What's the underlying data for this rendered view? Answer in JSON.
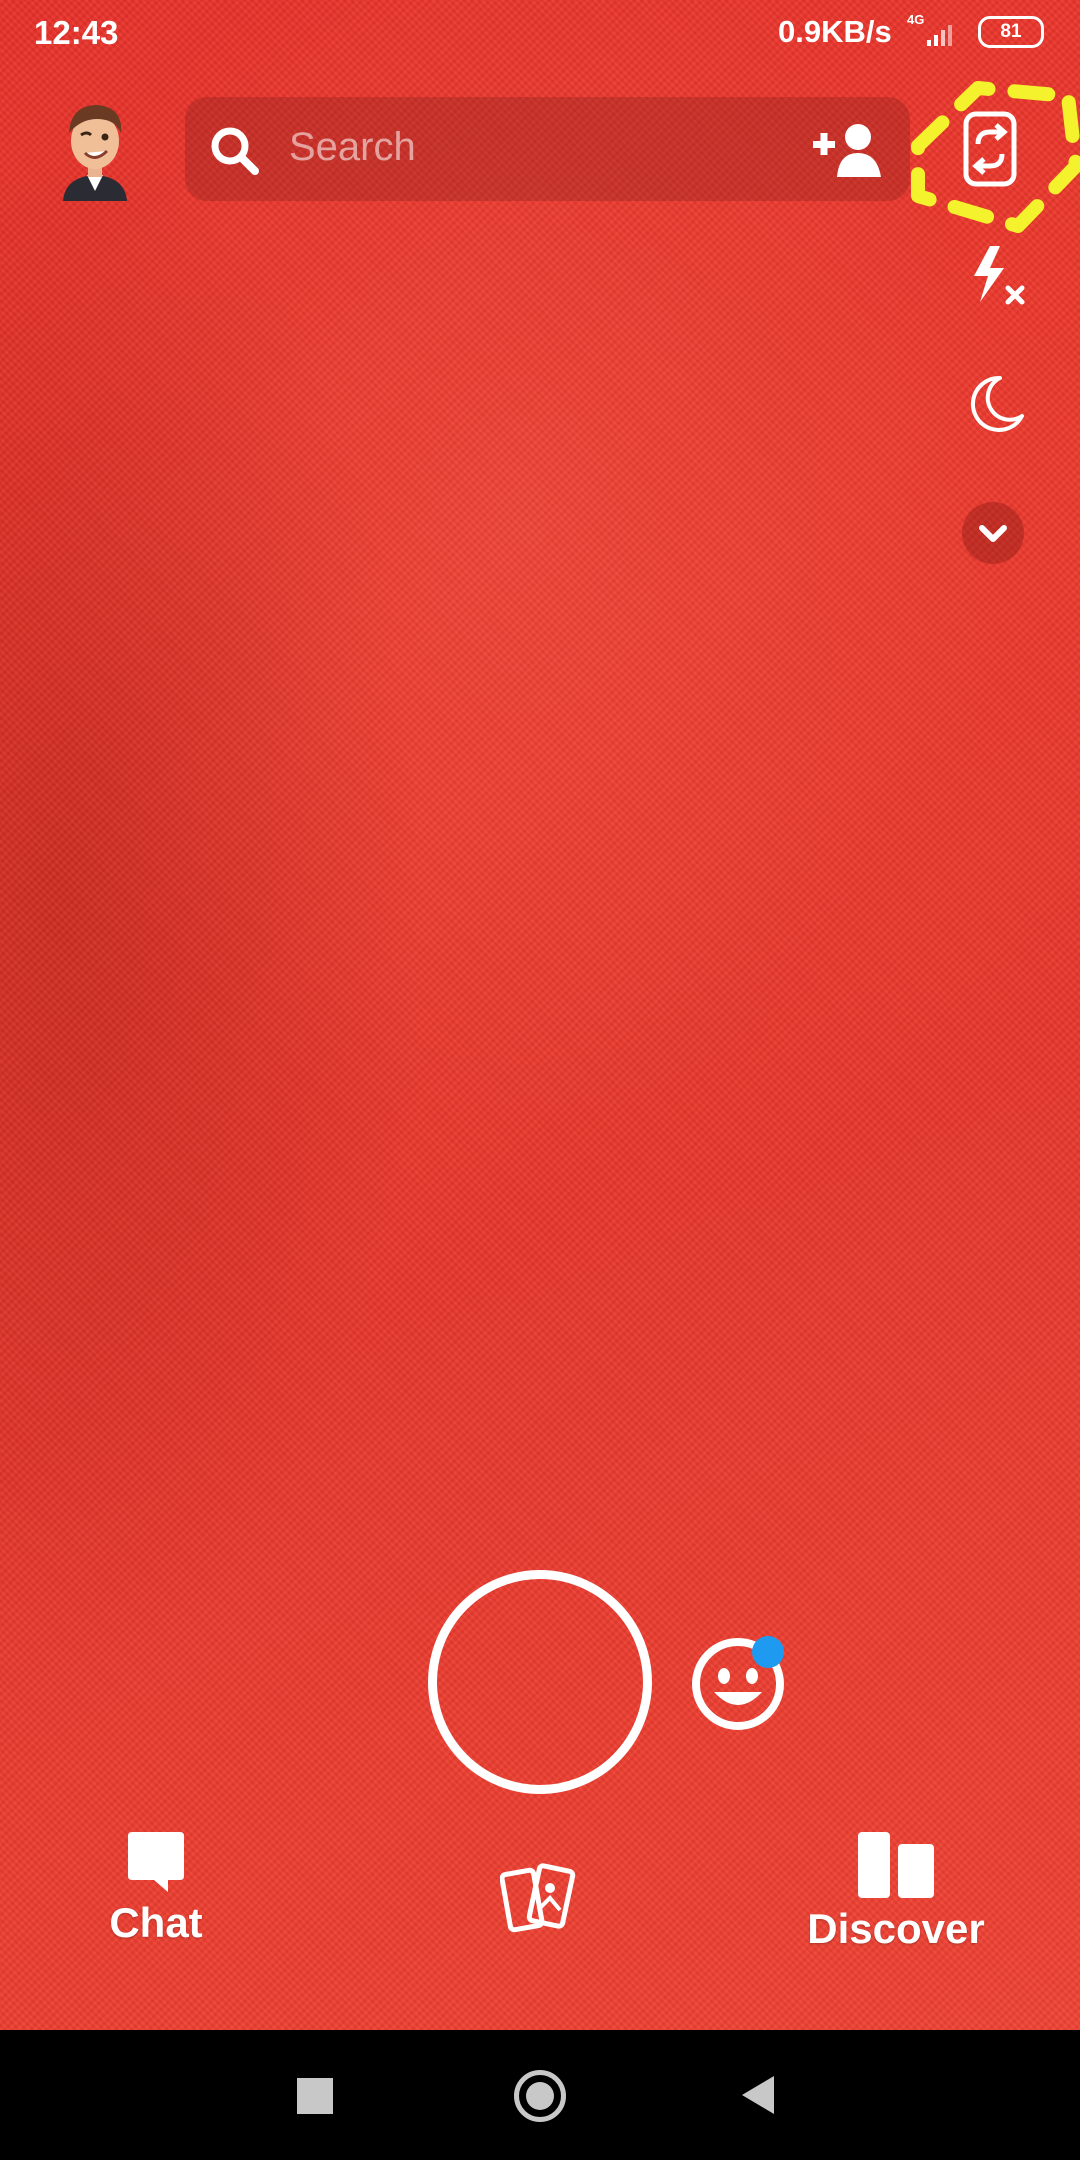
{
  "status_bar": {
    "time": "12:43",
    "speed": "0.9KB/s",
    "network": "4G",
    "battery": "81"
  },
  "top_bar": {
    "search_placeholder": "Search",
    "icons": [
      "bitmoji-avatar",
      "search-icon",
      "add-friend-icon",
      "flip-camera-icon"
    ]
  },
  "side_tools": [
    "flash-off-icon",
    "night-mode-icon",
    "chevron-down-icon"
  ],
  "capture": {
    "lens_indicator_color": "#1e9bf0"
  },
  "bottom_nav": {
    "chat": "Chat",
    "discover": "Discover"
  },
  "colors": {
    "camera_background": "#ec3a2e",
    "highlight": "#f3f22c",
    "system_nav": "#000000"
  }
}
